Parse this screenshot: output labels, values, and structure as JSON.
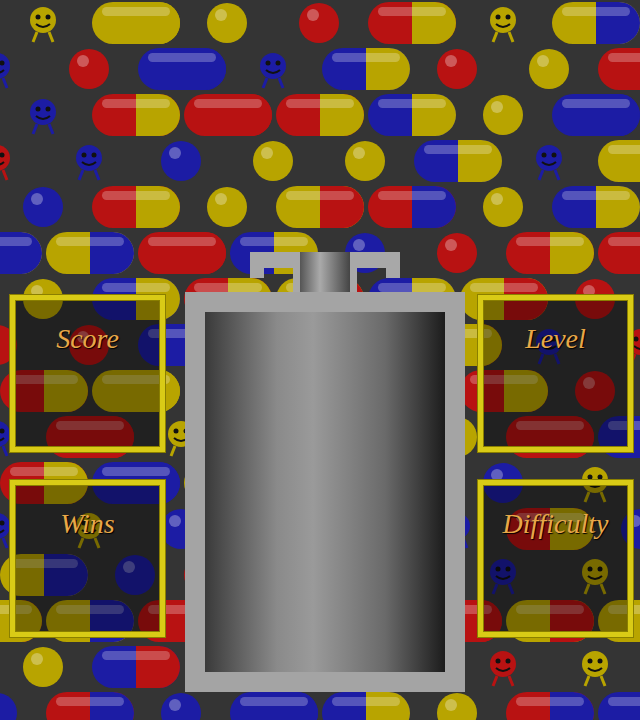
{
  "left_panels": [
    {
      "label": "Score"
    },
    {
      "label": "Wins"
    }
  ],
  "right_panels": [
    {
      "label": "Level"
    },
    {
      "label": "Difficulty"
    }
  ]
}
